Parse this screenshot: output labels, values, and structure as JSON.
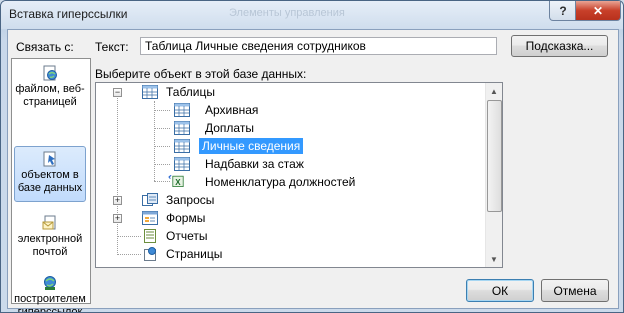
{
  "window": {
    "title": "Вставка гиперссылки",
    "ghost_title": "Элементы управления",
    "help_label": "?",
    "close_label": "✕"
  },
  "link_with": {
    "label": "Связать с:",
    "items": [
      {
        "label": "файлом, веб-страницей",
        "icon": "web-page-icon"
      },
      {
        "label": "объектом в базе данных",
        "icon": "database-object-icon",
        "selected": true
      },
      {
        "label": "электронной почтой",
        "icon": "email-icon"
      },
      {
        "label": "построителем гиперссылок",
        "icon": "hyperlink-builder-icon"
      }
    ]
  },
  "text_field": {
    "label": "Текст:",
    "value": "Таблица Личные сведения сотрудников"
  },
  "hint_button": "Подсказка...",
  "select_label": "Выберите объект в этой базе данных:",
  "tree": {
    "tables_label": "Таблицы",
    "table_items": [
      "Архивная",
      "Доплаты",
      "Личные сведения",
      "Надбавки за стаж",
      "Номенклатура должностей"
    ],
    "selected_item": "Личные сведения",
    "queries_label": "Запросы",
    "forms_label": "Формы",
    "reports_label": "Отчеты",
    "pages_label": "Страницы"
  },
  "buttons": {
    "ok": "ОК",
    "cancel": "Отмена"
  }
}
